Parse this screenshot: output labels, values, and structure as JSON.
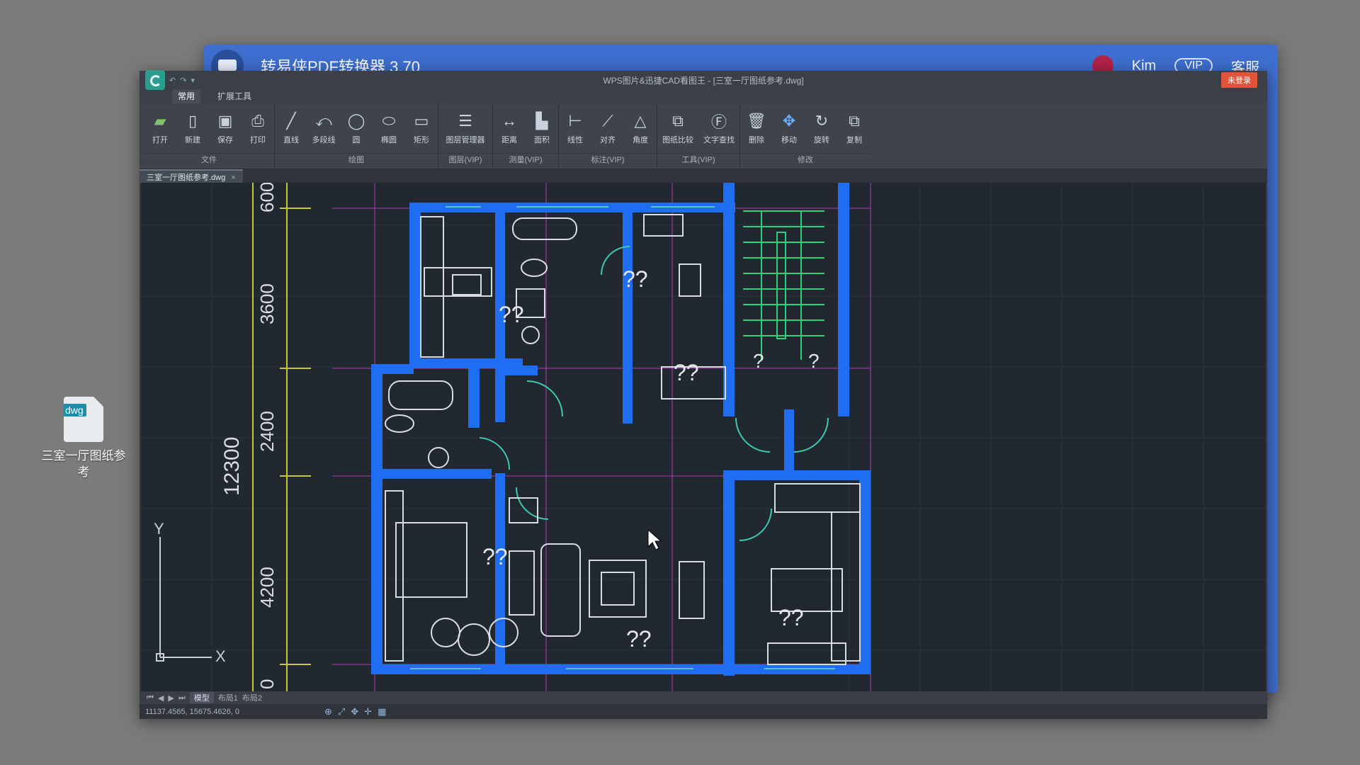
{
  "desktop": {
    "file_badge": "dwg",
    "file_name": "三室一厅图纸参考"
  },
  "converter": {
    "title": "转易侠PDF转换器 3.70",
    "user": "Kim",
    "vip": "VIP",
    "service": "客服"
  },
  "cad": {
    "window_title": "WPS图片&迅捷CAD看图王 - [三室一厅图纸参考.dwg]",
    "login_label": "未登录",
    "tabs": [
      "常用",
      "扩展工具"
    ],
    "active_tab": 0,
    "ribbon_groups": [
      {
        "name": "文件",
        "tools": [
          "打开",
          "新建",
          "保存",
          "打印"
        ]
      },
      {
        "name": "绘图",
        "tools": [
          "直线",
          "多段线",
          "圆",
          "椭圆",
          "矩形"
        ]
      },
      {
        "name": "图层(VIP)",
        "tools": [
          "图层管理器"
        ]
      },
      {
        "name": "测量(VIP)",
        "tools": [
          "距离",
          "面积"
        ]
      },
      {
        "name": "标注(VIP)",
        "tools": [
          "线性",
          "对齐",
          "角度"
        ]
      },
      {
        "name": "工具(VIP)",
        "tools": [
          "图纸比较",
          "文字查找"
        ]
      },
      {
        "name": "修改",
        "tools": [
          "删除",
          "移动",
          "旋转",
          "复制"
        ]
      }
    ],
    "doc_tab": "三室一厅图纸参考.dwg",
    "layout_tabs": [
      "模型",
      "布局1",
      "布局2"
    ],
    "status_coords": "11137.4565, 15675.4626, 0",
    "dimensions": {
      "overall": "12300",
      "segments": [
        "600",
        "3600",
        "2400",
        "4200",
        "0"
      ]
    },
    "room_labels": [
      "??",
      "??",
      "??",
      "?",
      "?",
      "??",
      "??",
      "??"
    ],
    "axis": {
      "x": "X",
      "y": "Y"
    }
  }
}
